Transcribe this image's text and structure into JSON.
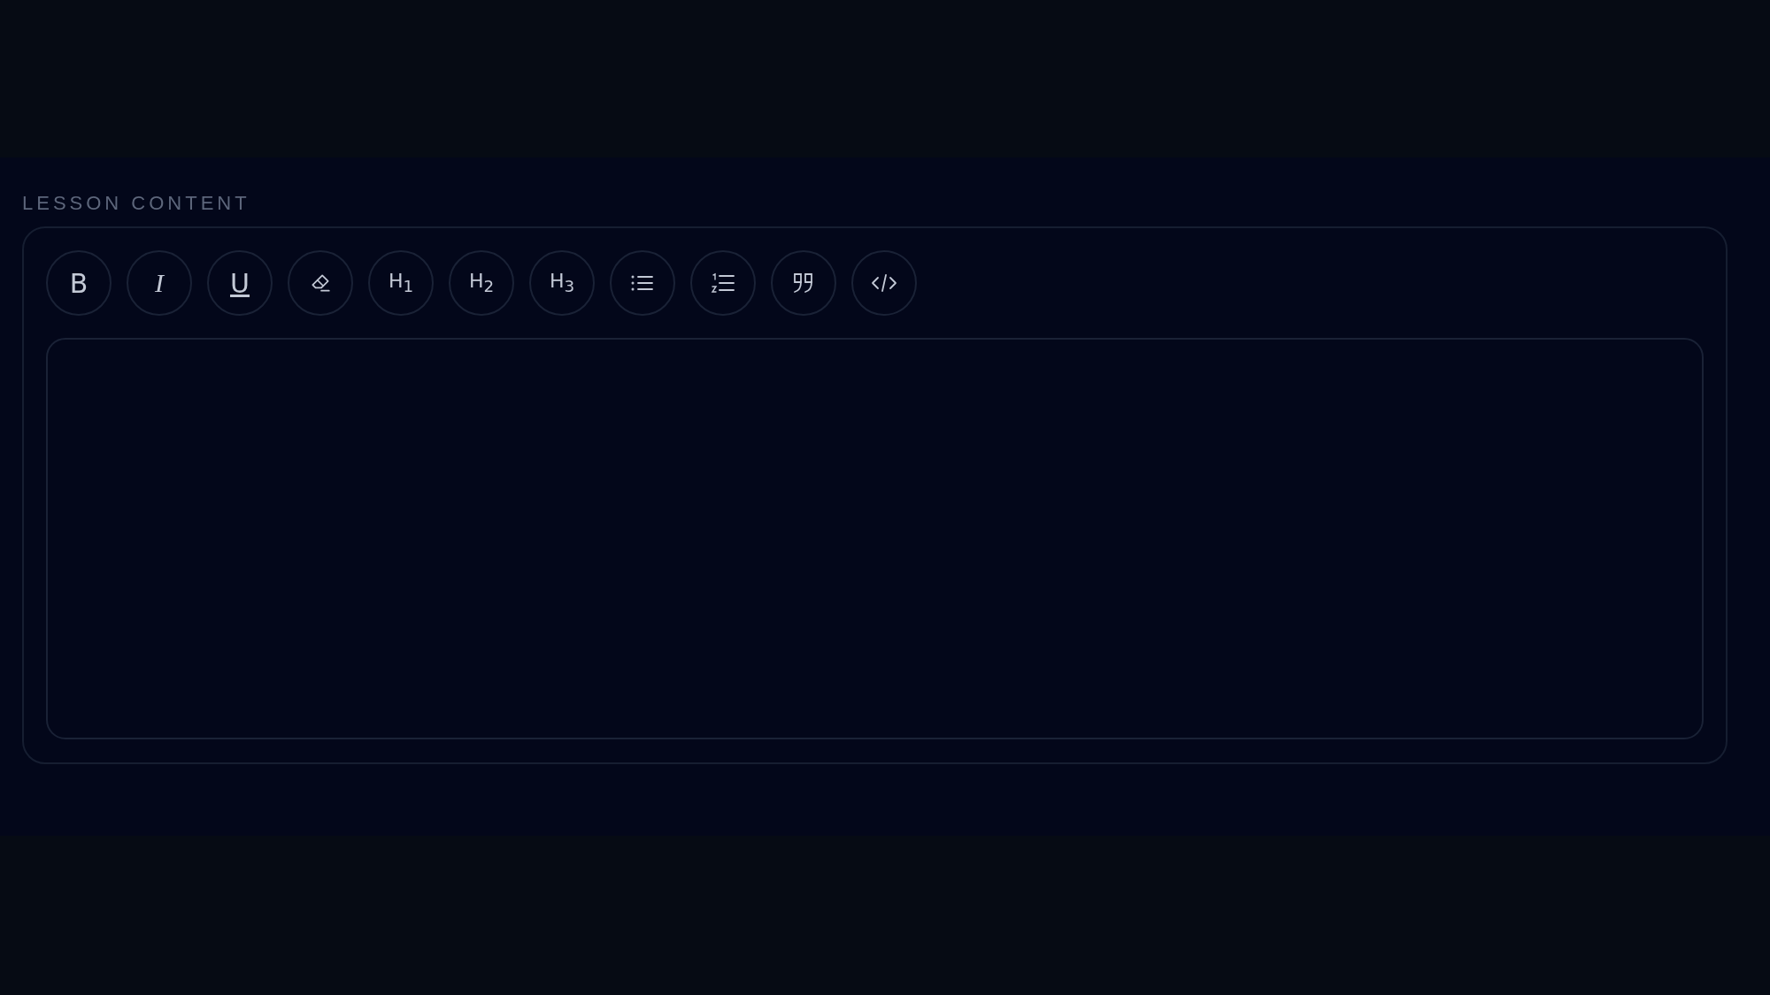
{
  "section": {
    "label": "LESSON CONTENT"
  },
  "toolbar": [
    {
      "kind": "bold",
      "label": "B"
    },
    {
      "kind": "italic",
      "label": "I"
    },
    {
      "kind": "underline",
      "label": "U"
    },
    {
      "kind": "eraser"
    },
    {
      "kind": "heading",
      "label": "H$_{1}$"
    },
    {
      "kind": "heading",
      "label": "H$_{2}$"
    },
    {
      "kind": "heading",
      "label": "H$_{3}$"
    },
    {
      "kind": "bullet-list"
    },
    {
      "kind": "numbered-list"
    },
    {
      "kind": "quote"
    },
    {
      "kind": "code"
    }
  ],
  "editor": {
    "kind": "rich-text"
  }
}
